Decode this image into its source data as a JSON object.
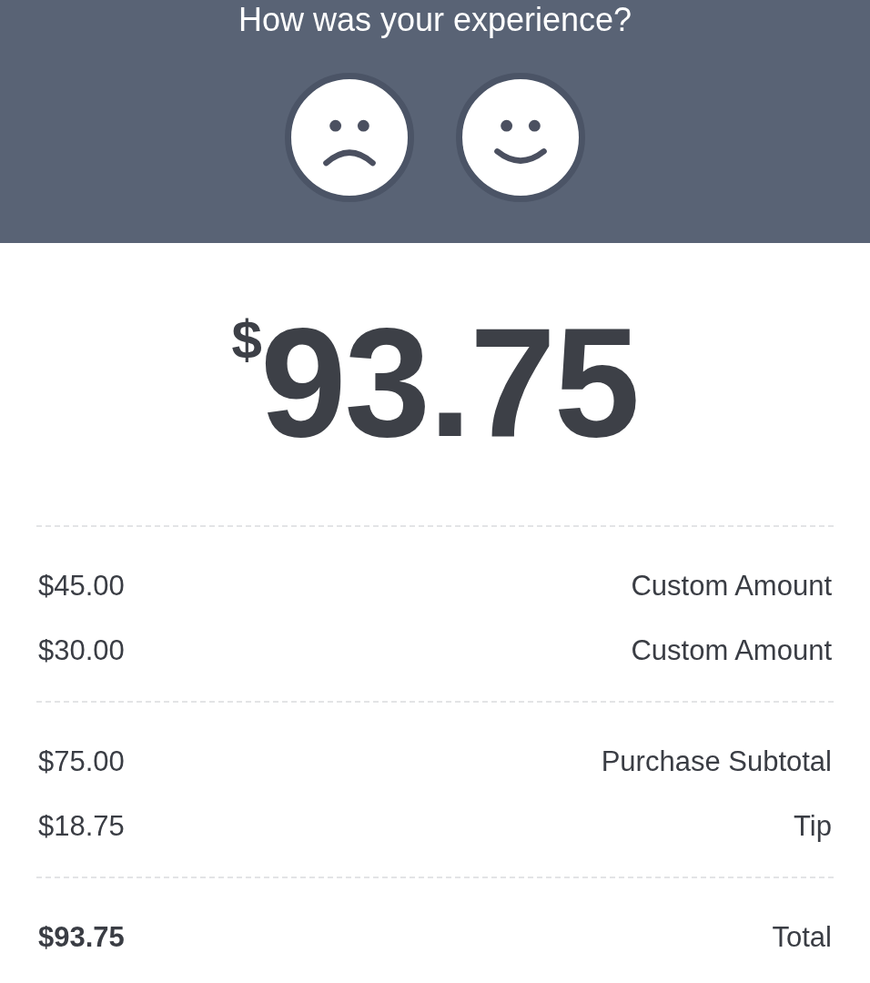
{
  "feedback": {
    "prompt": "How was your experience?",
    "options": [
      {
        "kind": "sad"
      },
      {
        "kind": "happy"
      }
    ]
  },
  "amount": {
    "currency": "$",
    "value": "93.75"
  },
  "sections": [
    {
      "lines": [
        {
          "label": "Custom Amount",
          "value": "$45.00",
          "bold": false
        },
        {
          "label": "Custom Amount",
          "value": "$30.00",
          "bold": false
        }
      ]
    },
    {
      "lines": [
        {
          "label": "Purchase Subtotal",
          "value": "$75.00",
          "bold": false
        },
        {
          "label": "Tip",
          "value": "$18.75",
          "bold": false
        }
      ]
    },
    {
      "lines": [
        {
          "label": "Total",
          "value": "$93.75",
          "bold": true
        }
      ]
    }
  ]
}
